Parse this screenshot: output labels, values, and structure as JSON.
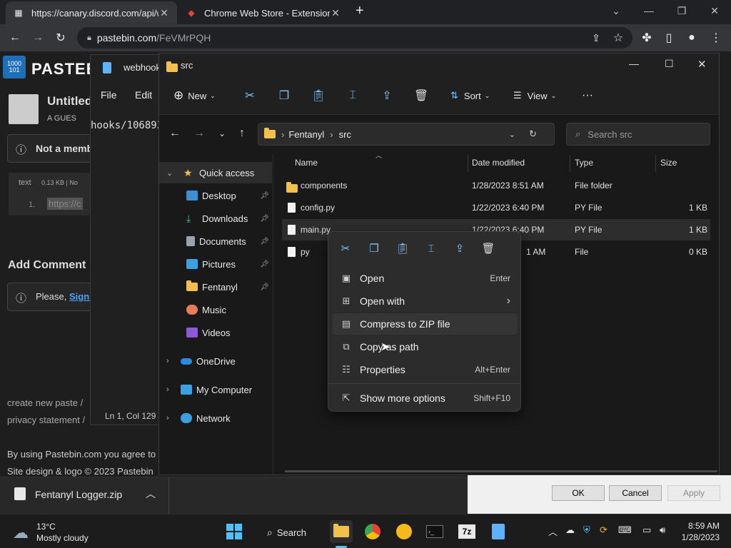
{
  "browser": {
    "tabs": [
      {
        "label": "https://canary.discord.com/api/w",
        "close": "✕"
      },
      {
        "label": "Chrome Web Store - Extensions",
        "close": "✕"
      }
    ],
    "new_tab": "+",
    "url_host": "pastebin.com",
    "url_path": "/FeVMrPQH"
  },
  "pastebin": {
    "brand": "PASTEB",
    "logo_text": "1000 101",
    "paste_title": "Untitled",
    "guest": "A GUES",
    "not_member": "Not a memb",
    "code_lang": "text",
    "code_meta": "0.13 KB | No",
    "code_line_no": "1.",
    "code_line": "https://c",
    "add_comment": "Add Comment",
    "please": "Please,",
    "sign_in": "Sign I",
    "footer_new": "create new paste  /",
    "footer_privacy": "privacy statement  /",
    "footer_agree": "By using Pastebin.com you agree to o",
    "footer_copy": "Site design & logo © 2023 Pastebin"
  },
  "notepad": {
    "title": "webhook",
    "menu_file": "File",
    "menu_edit": "Edit",
    "text": "hooks/106893",
    "status": "Ln 1, Col 129"
  },
  "explorer": {
    "title": "src",
    "cmd": {
      "new": "New",
      "sort": "Sort",
      "view": "View",
      "more": "···"
    },
    "breadcrumb": [
      "Fentanyl",
      "src"
    ],
    "search_placeholder": "Search src",
    "nav": [
      {
        "label": "Quick access"
      },
      {
        "label": "Desktop"
      },
      {
        "label": "Downloads"
      },
      {
        "label": "Documents"
      },
      {
        "label": "Pictures"
      },
      {
        "label": "Fentanyl"
      },
      {
        "label": "Music"
      },
      {
        "label": "Videos"
      },
      {
        "label": "OneDrive"
      },
      {
        "label": "My Computer"
      },
      {
        "label": "Network"
      }
    ],
    "columns": {
      "name": "Name",
      "date": "Date modified",
      "type": "Type",
      "size": "Size"
    },
    "files": [
      {
        "name": "components",
        "date": "1/28/2023 8:51 AM",
        "type": "File folder",
        "size": ""
      },
      {
        "name": "config.py",
        "date": "1/22/2023 6:40 PM",
        "type": "PY File",
        "size": "1 KB"
      },
      {
        "name": "main.py",
        "date": "1/22/2023 6:40 PM",
        "type": "PY File",
        "size": "1 KB"
      },
      {
        "name": "py",
        "date": "1 AM",
        "type": "File",
        "size": "0 KB"
      }
    ]
  },
  "context_menu": {
    "items": [
      {
        "label": "Open",
        "shortcut": "Enter"
      },
      {
        "label": "Open with",
        "shortcut": "›"
      },
      {
        "label": "Compress to ZIP file",
        "shortcut": ""
      },
      {
        "label": "Copy as path",
        "shortcut": ""
      },
      {
        "label": "Properties",
        "shortcut": "Alt+Enter"
      },
      {
        "label": "Show more options",
        "shortcut": "Shift+F10"
      }
    ]
  },
  "download": {
    "file": "Fentanyl Logger.zip"
  },
  "dialog": {
    "ok": "OK",
    "cancel": "Cancel",
    "apply": "Apply"
  },
  "taskbar": {
    "weather_temp": "13°C",
    "weather_desc": "Mostly cloudy",
    "search": "Search",
    "time": "8:59 AM",
    "date": "1/28/2023"
  }
}
